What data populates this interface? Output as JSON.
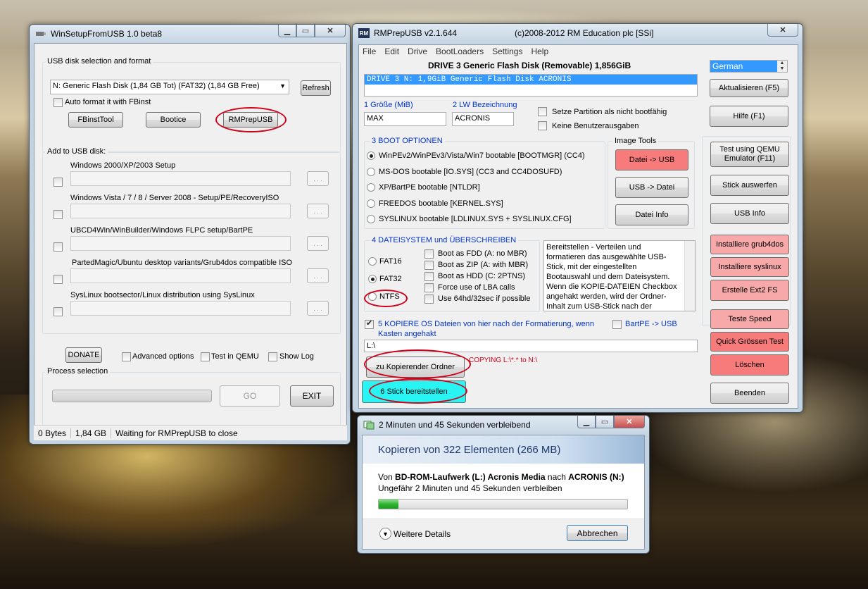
{
  "winsetup": {
    "title": "WinSetupFromUSB 1.0 beta8",
    "usb_group": "USB disk selection and format",
    "disk_select": "N: Generic Flash Disk (1,84 GB Tot) (FAT32) (1,84 GB Free)",
    "refresh": "Refresh",
    "auto_format": "Auto format it with FBinst",
    "fbinsttool": "FBinstTool",
    "bootice": "Bootice",
    "rmprepusb": "RMPrepUSB",
    "add_group": "Add to USB disk:",
    "sources": [
      {
        "label": "Windows 2000/XP/2003 Setup"
      },
      {
        "label": "Windows Vista / 7 / 8 / Server 2008 - Setup/PE/RecoveryISO"
      },
      {
        "label": "UBCD4Win/WinBuilder/Windows FLPC setup/BartPE"
      },
      {
        "label": "PartedMagic/Ubuntu desktop variants/Grub4dos compatible ISO"
      },
      {
        "label": "SysLinux bootsector/Linux distribution using SysLinux"
      }
    ],
    "browse": ". . .",
    "donate": "DONATE",
    "advanced": "Advanced options",
    "test_qemu": "Test in QEMU",
    "show_log": "Show Log",
    "process": "Process selection",
    "go": "GO",
    "exit": "EXIT",
    "status": {
      "size": "0 Bytes",
      "total": "1,84 GB",
      "msg": "Waiting for RMPrepUSB to close"
    }
  },
  "rmprep": {
    "title": "RMPrepUSB v2.1.644",
    "copyright": "(c)2008-2012 RM Education plc [SSi]",
    "menu": [
      "File",
      "Edit",
      "Drive",
      "BootLoaders",
      "Settings",
      "Help"
    ],
    "drive_header": "DRIVE 3 Generic Flash Disk  (Removable) 1,856GiB",
    "drive_row": "DRIVE 3   N:     1,9GiB  Generic Flash Disk         ACRONIS",
    "language": "German",
    "size_label": "1 Größe (MiB)",
    "size_value": "MAX",
    "vol_label": "2 LW Bezeichnung",
    "vol_value": "ACRONIS",
    "opt_nonboot": "Setze Partition als nicht bootfähig",
    "opt_noprompt": "Keine Benutzerausgaben",
    "boot_group": "3 BOOT OPTIONEN",
    "boot_options": [
      {
        "label": "WinPEv2/WinPEv3/Vista/Win7 bootable [BOOTMGR] (CC4)",
        "selected": true
      },
      {
        "label": "MS-DOS bootable [IO.SYS]    (CC3 and CC4DOSUFD)",
        "selected": false
      },
      {
        "label": "XP/BartPE bootable [NTLDR]",
        "selected": false
      },
      {
        "label": "FREEDOS bootable [KERNEL.SYS]",
        "selected": false
      },
      {
        "label": "SYSLINUX bootable [LDLINUX.SYS + SYSLINUX.CFG]",
        "selected": false
      }
    ],
    "image_tools": "Image Tools",
    "file_to_usb": "Datei -> USB",
    "usb_to_file": "USB -> Datei",
    "file_info": "Datei Info",
    "fs_group": "4 DATEISYSTEM und ÜBERSCHREIBEN",
    "fs": [
      {
        "label": "FAT16",
        "selected": false
      },
      {
        "label": "FAT32",
        "selected": true
      },
      {
        "label": "NTFS",
        "selected": false
      }
    ],
    "fs_opts": [
      "Boot as FDD (A: no MBR)",
      "Boot as ZIP (A: with MBR)",
      "Boot as HDD (C: 2PTNS)",
      "Force use of LBA calls",
      "Use 64hd/32sec if possible"
    ],
    "info_text": "Bereitstellen - Verteilen und formatieren das ausgewählte USB-Stick, mit der eingestellten Bootauswahl und dem Dateisystem. Wenn die KOPIE-DATEIEN Checkbox angehakt werden, wird der Ordner-Inhalt zum USB-Stick nach der",
    "copy_label": "5 KOPIERE OS Dateien von hier nach der Formatierung, wenn Kasten angehakt",
    "bartpe": "BartPE -> USB",
    "copy_path": "L:\\",
    "copy_folder": "zu Kopierender Ordner",
    "copy_msg": "COPYING L:\\*.* to N:\\",
    "prepare": "6 Stick bereitstellen",
    "refresh": "Aktualisieren (F5)",
    "help": "Hilfe (F1)",
    "qemu": "Test using QEMU Emulator (F11)",
    "eject": "Stick auswerfen",
    "usb_info": "USB Info",
    "grub4dos": "Installiere grub4dos",
    "syslinux": "Installiere syslinux",
    "ext2": "Erstelle Ext2 FS",
    "speed": "Teste Speed",
    "quick": "Quick Grössen Test",
    "delete": "Löschen",
    "quit": "Beenden",
    "colors": {
      "pink": "#f7a8a8",
      "red": "#f77b7b",
      "cyan": "#29f4f4",
      "oval": "#d0021b"
    }
  },
  "copy": {
    "title": "2 Minuten und 45 Sekunden verbleibend",
    "heading": "Kopieren von 322 Elementen (266 MB)",
    "from_pre": "Von ",
    "from_src": "BD-ROM-Laufwerk (L:) Acronis Media",
    "from_mid": " nach ",
    "from_dst": "ACRONIS (N:)",
    "remaining": "Ungefähr 2 Minuten und 45 Sekunden verbleiben",
    "progress": 0.08,
    "details": "Weitere Details",
    "cancel": "Abbrechen"
  }
}
